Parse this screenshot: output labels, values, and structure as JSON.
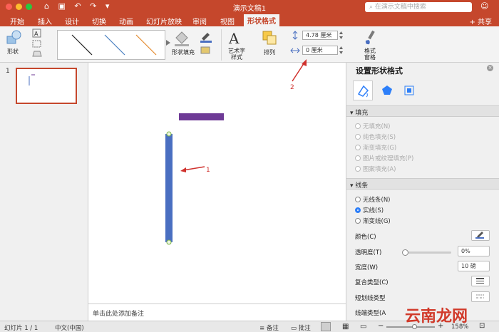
{
  "window": {
    "title": "演示文稿1"
  },
  "quick_access": {
    "home": "⌂",
    "save": "▣",
    "undo": "↶",
    "redo": "↷",
    "more": "▾"
  },
  "search": {
    "placeholder": "在演示文稿中搜索"
  },
  "tabs": [
    {
      "label": "开始"
    },
    {
      "label": "插入"
    },
    {
      "label": "设计"
    },
    {
      "label": "切换"
    },
    {
      "label": "动画"
    },
    {
      "label": "幻灯片放映"
    },
    {
      "label": "审阅"
    },
    {
      "label": "视图"
    },
    {
      "label": "形状格式"
    }
  ],
  "share_label": "+ 共享",
  "ribbon": {
    "shapes_label": "形状",
    "fill_label": "形状填充",
    "wordart_label": "艺术字\n样式",
    "arrange_label": "排列",
    "height_value": "4.78 厘米",
    "width_value": "0 厘米",
    "pane_label": "格式\n窗格"
  },
  "slides": [
    {
      "number": "1"
    }
  ],
  "notes_placeholder": "单击此处添加备注",
  "annotations": {
    "arrow1": "1",
    "arrow2": "2"
  },
  "format_pane": {
    "title": "设置形状格式",
    "fill": {
      "header": "填充",
      "options": [
        "无填充(N)",
        "纯色填充(S)",
        "渐变填充(G)",
        "图片或纹理填充(P)",
        "图案填充(A)"
      ]
    },
    "line": {
      "header": "线条",
      "options": [
        "无线条(N)",
        "实线(S)",
        "渐变线(G)"
      ],
      "selected": "实线(S)",
      "color_label": "颜色(C)",
      "transparency_label": "透明度(T)",
      "transparency_value": "0%",
      "transparency": 0,
      "width_label": "宽度(W)",
      "width_value": "10 磅",
      "compound_label": "复合类型(C)",
      "dash_label": "短划线类型",
      "cap_label": "线端类型(A"
    }
  },
  "status": {
    "slide_info": "幻灯片 1 / 1",
    "language": "中文(中国)",
    "notes": "备注",
    "comments": "批注",
    "zoom": "158%",
    "zoom_minus": "−",
    "zoom_plus": "+"
  },
  "watermark": "云南龙网",
  "colors": {
    "accent": "#c5472c",
    "line_blue": "#4a6fc1",
    "purple": "#6e3a96",
    "annotation_red": "#d0312d"
  }
}
